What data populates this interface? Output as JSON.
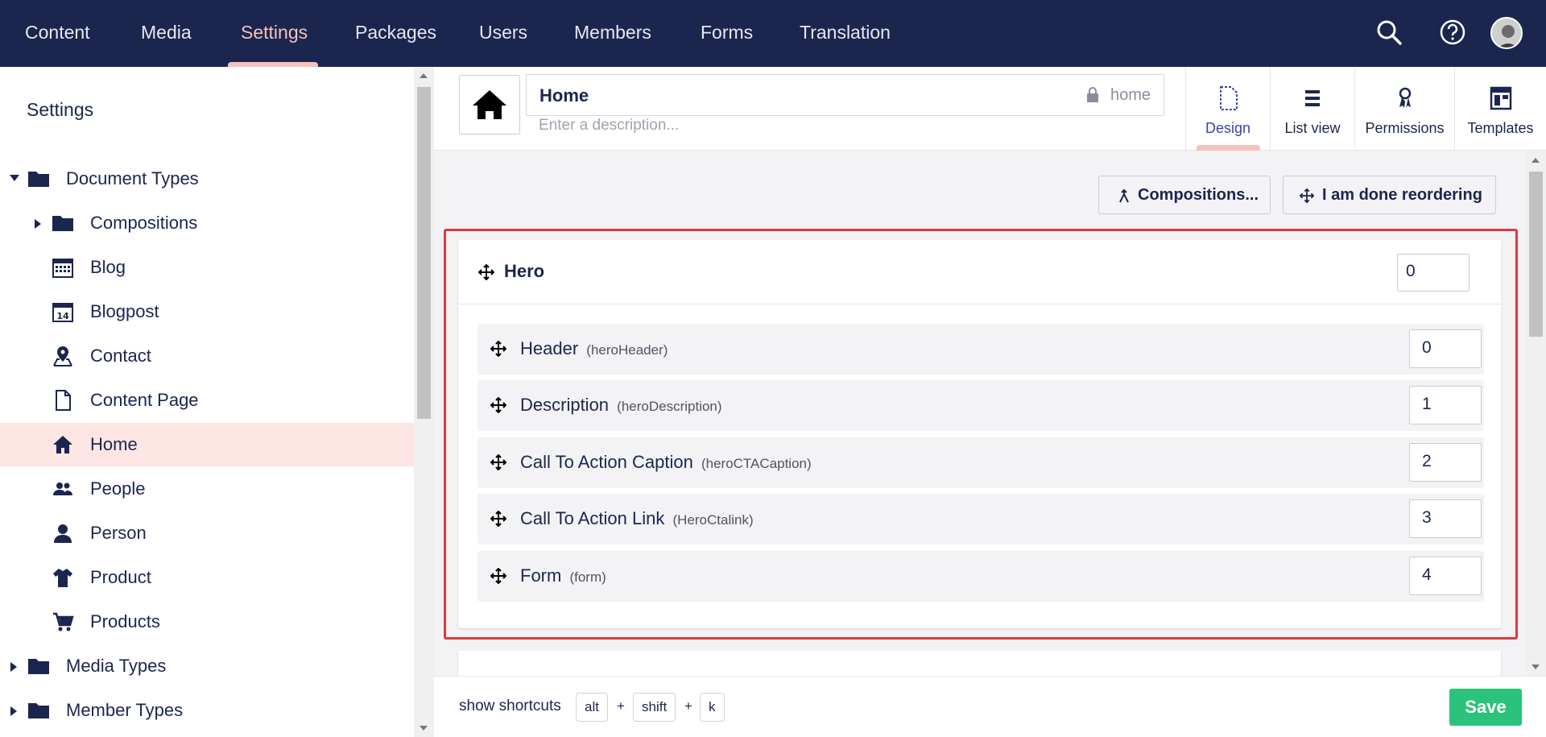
{
  "nav": {
    "items": [
      {
        "label": "Content"
      },
      {
        "label": "Media"
      },
      {
        "label": "Settings"
      },
      {
        "label": "Packages"
      },
      {
        "label": "Users"
      },
      {
        "label": "Members"
      },
      {
        "label": "Forms"
      },
      {
        "label": "Translation"
      }
    ],
    "active": "Settings"
  },
  "sidebar": {
    "title": "Settings",
    "items": [
      {
        "label": "Document Types",
        "icon": "folder-icon"
      },
      {
        "label": "Compositions",
        "icon": "folder-icon"
      },
      {
        "label": "Blog",
        "icon": "calendar-icon"
      },
      {
        "label": "Blogpost",
        "icon": "calendar-14-icon"
      },
      {
        "label": "Contact",
        "icon": "map-pin-icon"
      },
      {
        "label": "Content Page",
        "icon": "document-icon"
      },
      {
        "label": "Home",
        "icon": "home-icon"
      },
      {
        "label": "People",
        "icon": "users-icon"
      },
      {
        "label": "Person",
        "icon": "user-icon"
      },
      {
        "label": "Product",
        "icon": "shirt-icon"
      },
      {
        "label": "Products",
        "icon": "cart-icon"
      },
      {
        "label": "Media Types",
        "icon": "folder-icon"
      },
      {
        "label": "Member Types",
        "icon": "folder-icon"
      }
    ],
    "active": "Home"
  },
  "header": {
    "name": "Home",
    "alias": "home",
    "description_placeholder": "Enter a description...",
    "tabs": [
      {
        "label": "Design"
      },
      {
        "label": "List view"
      },
      {
        "label": "Permissions"
      },
      {
        "label": "Templates"
      }
    ],
    "active_tab": "Design"
  },
  "toolbar": {
    "compositions_label": "Compositions...",
    "reorder_label": "I am done reordering"
  },
  "group": {
    "title": "Hero",
    "sort": "0",
    "properties": [
      {
        "label": "Header",
        "alias": "(heroHeader)",
        "sort": "0"
      },
      {
        "label": "Description",
        "alias": "(heroDescription)",
        "sort": "1"
      },
      {
        "label": "Call To Action Caption",
        "alias": "(heroCTACaption)",
        "sort": "2"
      },
      {
        "label": "Call To Action Link",
        "alias": "(HeroCtalink)",
        "sort": "3"
      },
      {
        "label": "Form",
        "alias": "(form)",
        "sort": "4"
      }
    ]
  },
  "footer": {
    "shortcuts_label": "show shortcuts",
    "keys": [
      "alt",
      "shift",
      "k"
    ],
    "plus": "+",
    "save_label": "Save"
  },
  "colors": {
    "nav_bg": "#1b264f",
    "accent": "#f5c1bc",
    "active_row": "#fde5e3",
    "save": "#2bc37c",
    "highlight_border": "#e0393e"
  }
}
